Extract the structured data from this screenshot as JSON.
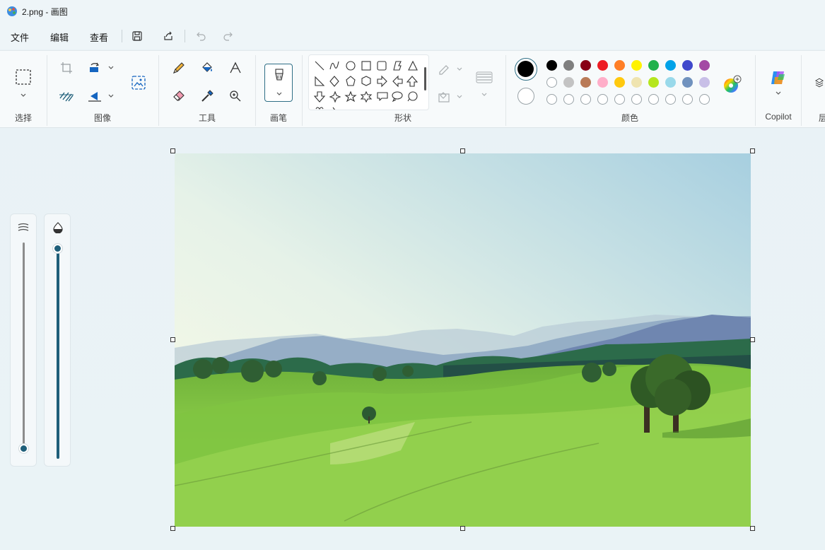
{
  "window": {
    "title": "2.png - 画图"
  },
  "menu": {
    "file": "文件",
    "edit": "编辑",
    "view": "查看"
  },
  "ribbon": {
    "groups": {
      "select": "选择",
      "image": "图像",
      "tools": "工具",
      "brushes": "画笔",
      "shapes": "形状",
      "colors": "颜色",
      "copilot": "Copilot",
      "layers": "层"
    }
  },
  "colors": {
    "current_primary": "#000000",
    "current_secondary": "#ffffff",
    "palette_row1": [
      "#000000",
      "#7f7f7f",
      "#880015",
      "#ed1c24",
      "#ff7f27",
      "#fff200",
      "#22b14c",
      "#00a2e8",
      "#3f48cc",
      "#a349a4"
    ],
    "palette_row2": [
      "#ffffff",
      "#c3c3c3",
      "#b97a57",
      "#ffaec9",
      "#ffc90e",
      "#efe4b0",
      "#b5e61d",
      "#99d9ea",
      "#7092be",
      "#c8bfe7"
    ],
    "palette_row3_empty": 10,
    "accent": "#2f6f86"
  },
  "sliders": {
    "size_level": 0.0,
    "opacity_level": 1.0
  },
  "canvas": {
    "description_hidden": ""
  }
}
